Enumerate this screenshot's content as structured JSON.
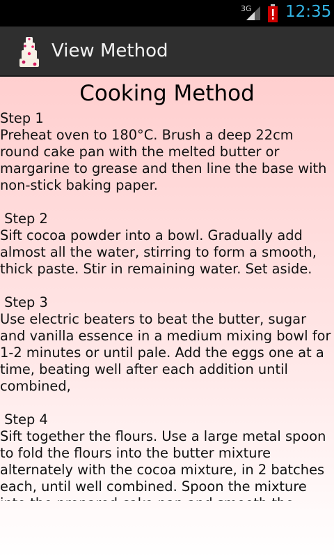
{
  "status_bar": {
    "network": "3G",
    "time": "12:35"
  },
  "action_bar": {
    "title": "View Method",
    "logo_icon": "wedding-cake-icon"
  },
  "content": {
    "title": "Cooking Method",
    "steps": [
      {
        "label": "Step 1",
        "text": "Preheat oven to 180°C. Brush a deep 22cm round cake pan with the melted butter or margarine to grease and then line the base with non-stick baking paper."
      },
      {
        "label": " Step 2",
        "text": "Sift cocoa powder into a bowl. Gradually add almost all the water, stirring to form a smooth, thick paste. Stir in remaining water. Set aside."
      },
      {
        "label": " Step 3",
        "text": "Use electric beaters to beat the butter, sugar and vanilla essence in a medium mixing bowl for 1-2 minutes or until pale. Add the eggs one at a time, beating well after each addition until combined,"
      },
      {
        "label": " Step 4",
        "text": "Sift together the flours. Use a large metal spoon to fold the flours into the butter mixture alternately with the cocoa mixture, in 2 batches each, until well combined. Spoon the mixture into the prepared cake pan and smooth the surface with the back of the spoon."
      }
    ]
  },
  "colors": {
    "status_accent": "#33b5e5",
    "action_bar_bg": "#2f2f2f",
    "content_gradient_top": "#ffcfcf",
    "content_gradient_bottom": "#ffffff"
  }
}
